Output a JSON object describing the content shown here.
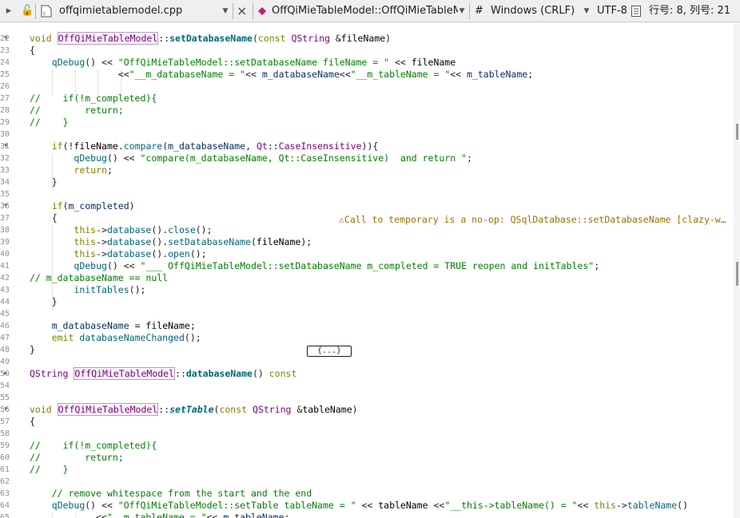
{
  "toolbar": {
    "file_name": "offqimietablemodel.cpp",
    "close_icon": "×",
    "symbol": "OffQiMieTableModel::OffQiMieTableM…",
    "hash": "#",
    "line_ending": "Windows (CRLF)",
    "encoding": "UTF-8",
    "position": "行号: 8, 列号: 21"
  },
  "icons": {
    "nav_back": "nav-back-icon",
    "lock": "lock-icon",
    "file": "cpp-file-icon",
    "split": "split-icon",
    "close": "close-icon",
    "symbol": "function-symbol-icon",
    "dropdown": "chevron-down-icon",
    "doc": "document-icon",
    "warning": "warning-icon"
  },
  "colors": {
    "keyword": "#808000",
    "type": "#800080",
    "function": "#00677c",
    "string": "#008000",
    "comment": "#008000",
    "member": "#092e64",
    "warning": "#a07000"
  },
  "editor": {
    "warning_text": "⚠Call to temporary is a no-op: QSqlDatabase::setDatabaseName [clazy-w…",
    "collapsed_block": "{...}",
    "lines": [
      {
        "n": "22",
        "fold": "▾",
        "segs": [
          [
            "kw",
            "void "
          ],
          [
            "cl",
            "OffQiMieTableModel"
          ],
          [
            "",
            "::"
          ],
          [
            "fnb",
            "setDatabaseName"
          ],
          [
            "",
            "("
          ],
          [
            "kw",
            "const "
          ],
          [
            "ty",
            "QString "
          ],
          [
            "",
            "&"
          ],
          [
            "ws",
            "fileName"
          ],
          [
            "",
            ")"
          ]
        ]
      },
      {
        "n": "23",
        "segs": [
          [
            "",
            "{"
          ]
        ]
      },
      {
        "n": "24",
        "segs": [
          [
            "",
            "    "
          ],
          [
            "fn",
            "qDebug"
          ],
          [
            "",
            "() << "
          ],
          [
            "st",
            "\"OffQiMieTableModel::setDatabaseName fileName = \""
          ],
          [
            "",
            " << "
          ],
          [
            "ws",
            "fileName"
          ]
        ]
      },
      {
        "n": "25",
        "segs": [
          [
            "",
            "                "
          ],
          [
            "",
            "<<"
          ],
          [
            "st",
            "\"__m_databaseName = \""
          ],
          [
            "",
            "<< "
          ],
          [
            "vr",
            "m_databaseName"
          ],
          [
            "",
            "<<"
          ],
          [
            "st",
            "\"__m_tableName = \""
          ],
          [
            "",
            "<< "
          ],
          [
            "vr",
            "m_tableName"
          ],
          [
            "",
            ";"
          ]
        ]
      },
      {
        "n": "26",
        "segs": []
      },
      {
        "n": "27",
        "segs": [
          [
            "cm",
            "//    if(!m_completed){"
          ]
        ]
      },
      {
        "n": "28",
        "segs": [
          [
            "cm",
            "//        return;"
          ]
        ]
      },
      {
        "n": "29",
        "segs": [
          [
            "cm",
            "//    }"
          ]
        ]
      },
      {
        "n": "30",
        "segs": []
      },
      {
        "n": "31",
        "fold": "▾",
        "segs": [
          [
            "",
            "    "
          ],
          [
            "kw",
            "if"
          ],
          [
            "",
            "(!"
          ],
          [
            "ws",
            "fileName"
          ],
          [
            "",
            "."
          ],
          [
            "fn",
            "compare"
          ],
          [
            "",
            "("
          ],
          [
            "vr",
            "m_databaseName"
          ],
          [
            "",
            ", "
          ],
          [
            "ty",
            "Qt"
          ],
          [
            "",
            "::"
          ],
          [
            "ty",
            "CaseInsensitive"
          ],
          [
            "",
            "))"
          ],
          [
            "",
            "{"
          ]
        ]
      },
      {
        "n": "32",
        "segs": [
          [
            "",
            "        "
          ],
          [
            "fn",
            "qDebug"
          ],
          [
            "",
            "() << "
          ],
          [
            "st",
            "\"compare(m_databaseName, Qt::CaseInsensitive)  and return \""
          ],
          [
            "",
            ";"
          ]
        ]
      },
      {
        "n": "33",
        "segs": [
          [
            "",
            "        "
          ],
          [
            "kw",
            "return"
          ],
          [
            "",
            ";"
          ]
        ]
      },
      {
        "n": "34",
        "segs": [
          [
            "",
            "    }"
          ]
        ]
      },
      {
        "n": "35",
        "segs": []
      },
      {
        "n": "36",
        "fold": "▾",
        "segs": [
          [
            "",
            "    "
          ],
          [
            "kw",
            "if"
          ],
          [
            "",
            "("
          ],
          [
            "vr",
            "m_completed"
          ],
          [
            "",
            ")"
          ]
        ]
      },
      {
        "n": "37",
        "segs": [
          [
            "",
            "    {"
          ]
        ]
      },
      {
        "n": "38",
        "segs": [
          [
            "",
            "        "
          ],
          [
            "kw",
            "this"
          ],
          [
            "",
            "->"
          ],
          [
            "fn",
            "database"
          ],
          [
            "",
            "()."
          ],
          [
            "fn",
            "close"
          ],
          [
            "",
            "();"
          ]
        ]
      },
      {
        "n": "39",
        "segs": [
          [
            "",
            "        "
          ],
          [
            "kw",
            "this"
          ],
          [
            "",
            "->"
          ],
          [
            "fn",
            "database"
          ],
          [
            "",
            "()."
          ],
          [
            "fn",
            "setDatabaseName"
          ],
          [
            "",
            "("
          ],
          [
            "ws",
            "fileName"
          ],
          [
            "",
            ");"
          ]
        ]
      },
      {
        "n": "40",
        "segs": [
          [
            "",
            "        "
          ],
          [
            "kw",
            "this"
          ],
          [
            "",
            "->"
          ],
          [
            "fn",
            "database"
          ],
          [
            "",
            "()."
          ],
          [
            "fn",
            "open"
          ],
          [
            "",
            "();"
          ]
        ]
      },
      {
        "n": "41",
        "segs": [
          [
            "",
            "        "
          ],
          [
            "fn",
            "qDebug"
          ],
          [
            "",
            "() << "
          ],
          [
            "st",
            "\"___ OffQiMieTableModel::setDatabaseName m_completed = TRUE reopen and initTables\""
          ],
          [
            "",
            ";"
          ]
        ]
      },
      {
        "n": "42",
        "segs": [
          [
            "cm",
            "// m_databaseName == null"
          ]
        ]
      },
      {
        "n": "43",
        "segs": [
          [
            "",
            "        "
          ],
          [
            "fn",
            "initTables"
          ],
          [
            "",
            "();"
          ]
        ]
      },
      {
        "n": "44",
        "segs": [
          [
            "",
            "    }"
          ]
        ]
      },
      {
        "n": "45",
        "segs": []
      },
      {
        "n": "46",
        "segs": [
          [
            "",
            "    "
          ],
          [
            "vr",
            "m_databaseName"
          ],
          [
            "",
            " = "
          ],
          [
            "ws",
            "fileName"
          ],
          [
            "",
            ";"
          ]
        ]
      },
      {
        "n": "47",
        "segs": [
          [
            "",
            "    "
          ],
          [
            "kw",
            "emit "
          ],
          [
            "fn",
            "databaseNameChanged"
          ],
          [
            "",
            "();"
          ]
        ]
      },
      {
        "n": "48",
        "segs": [
          [
            "",
            "}"
          ]
        ]
      },
      {
        "n": "49",
        "segs": []
      },
      {
        "n": "50",
        "fold": "▸",
        "segs": [
          [
            "ty",
            "QString "
          ],
          [
            "cl",
            "OffQiMieTableModel"
          ],
          [
            "",
            "::"
          ],
          [
            "fnb",
            "databaseName"
          ],
          [
            "",
            "() "
          ],
          [
            "kw",
            "const"
          ]
        ]
      },
      {
        "n": "54",
        "segs": []
      },
      {
        "n": "55",
        "segs": []
      },
      {
        "n": "56",
        "fold": "▾",
        "segs": [
          [
            "kw",
            "void "
          ],
          [
            "cl",
            "OffQiMieTableModel"
          ],
          [
            "",
            "::"
          ],
          [
            "fni",
            "setTable"
          ],
          [
            "",
            "("
          ],
          [
            "kw",
            "const "
          ],
          [
            "ty",
            "QString "
          ],
          [
            "",
            "&"
          ],
          [
            "ws",
            "tableName"
          ],
          [
            "",
            ")"
          ]
        ]
      },
      {
        "n": "57",
        "segs": [
          [
            "",
            "{"
          ]
        ]
      },
      {
        "n": "58",
        "segs": []
      },
      {
        "n": "59",
        "segs": [
          [
            "cm",
            "//    if(!m_completed){"
          ]
        ]
      },
      {
        "n": "60",
        "segs": [
          [
            "cm",
            "//        return;"
          ]
        ]
      },
      {
        "n": "61",
        "segs": [
          [
            "cm",
            "//    }"
          ]
        ]
      },
      {
        "n": "62",
        "segs": []
      },
      {
        "n": "63",
        "segs": [
          [
            "",
            "    "
          ],
          [
            "cm",
            "// remove whitespace from the start and the end"
          ]
        ]
      },
      {
        "n": "64",
        "segs": [
          [
            "",
            "    "
          ],
          [
            "fn",
            "qDebug"
          ],
          [
            "",
            "() << "
          ],
          [
            "st",
            "\"OffQiMieTableModel::setTable tableName = \""
          ],
          [
            "",
            " << "
          ],
          [
            "ws",
            "tableName"
          ],
          [
            "",
            " <<"
          ],
          [
            "st",
            "\"__this->tableName() = \""
          ],
          [
            "",
            "<< "
          ],
          [
            "kw",
            "this"
          ],
          [
            "",
            "->"
          ],
          [
            "fn",
            "tableName"
          ],
          [
            "",
            "()"
          ]
        ]
      },
      {
        "n": "65",
        "segs": [
          [
            "",
            "            <<"
          ],
          [
            "st",
            "\"__m_tableName = \""
          ],
          [
            "",
            "<< "
          ],
          [
            "vr",
            "m_tableName"
          ],
          [
            "",
            ";"
          ]
        ]
      }
    ]
  }
}
